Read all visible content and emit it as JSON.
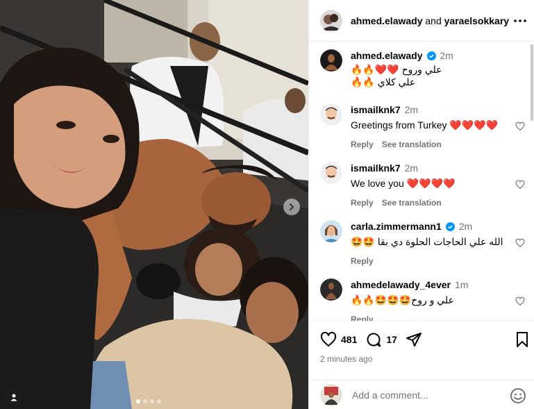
{
  "post": {
    "header": {
      "user": "ahmed.elawady",
      "conjunction": "and",
      "collaborator": "yaraelsokkary",
      "more_icon": "more-horizontal-icon"
    },
    "carousel": {
      "total_slides": 4,
      "active_slide": 1,
      "next_icon": "chevron-right-icon",
      "tag_icon": "user-tag-icon"
    },
    "caption": {
      "user": "ahmed.elawady",
      "verified": true,
      "time": "2m",
      "line1": "علي وروح ❤️❤️🔥🔥",
      "line2": "علي كلاي 🔥🔥"
    },
    "comments": [
      {
        "user": "ismailknk7",
        "verified": false,
        "time": "2m",
        "text": "Greetings from Turkey ❤️❤️❤️❤️",
        "reply": "Reply",
        "translate": "See translation"
      },
      {
        "user": "ismailknk7",
        "verified": false,
        "time": "2m",
        "text": "We love you ❤️❤️❤️❤️",
        "reply": "Reply",
        "translate": "See translation"
      },
      {
        "user": "carla.zimmermann1",
        "verified": true,
        "time": "2m",
        "text": "الله علي الحاجات الحلوة دي بقا 🤩🤩",
        "reply": "Reply"
      },
      {
        "user": "ahmedelawady_4ever",
        "verified": false,
        "time": "1m",
        "text": "علي و روح🤩🤩🤩🔥🔥",
        "reply": "Reply"
      }
    ],
    "actions": {
      "likes": "481",
      "comments": "17"
    },
    "timestamp": "2 minutes ago",
    "add_comment": {
      "placeholder": "Add a comment...",
      "emoji_icon": "emoji-icon"
    },
    "colors": {
      "verified": "#0095f6",
      "muted": "#737373",
      "heart": "#e0192c"
    }
  }
}
